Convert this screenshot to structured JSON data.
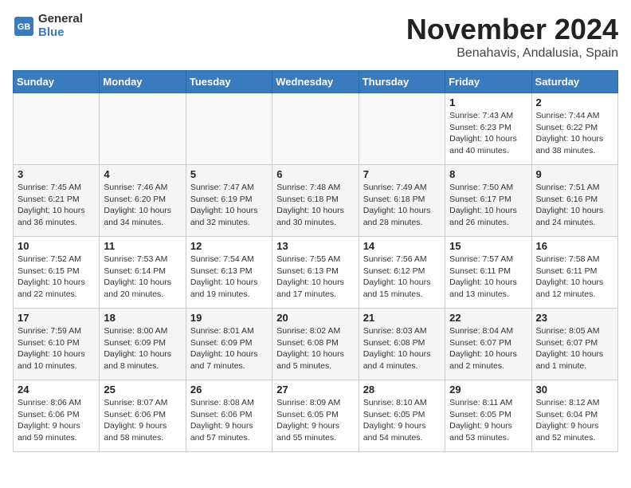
{
  "logo": {
    "line1": "General",
    "line2": "Blue"
  },
  "title": "November 2024",
  "location": "Benahavis, Andalusia, Spain",
  "days_of_week": [
    "Sunday",
    "Monday",
    "Tuesday",
    "Wednesday",
    "Thursday",
    "Friday",
    "Saturday"
  ],
  "weeks": [
    [
      {
        "day": "",
        "info": ""
      },
      {
        "day": "",
        "info": ""
      },
      {
        "day": "",
        "info": ""
      },
      {
        "day": "",
        "info": ""
      },
      {
        "day": "",
        "info": ""
      },
      {
        "day": "1",
        "info": "Sunrise: 7:43 AM\nSunset: 6:23 PM\nDaylight: 10 hours and 40 minutes."
      },
      {
        "day": "2",
        "info": "Sunrise: 7:44 AM\nSunset: 6:22 PM\nDaylight: 10 hours and 38 minutes."
      }
    ],
    [
      {
        "day": "3",
        "info": "Sunrise: 7:45 AM\nSunset: 6:21 PM\nDaylight: 10 hours and 36 minutes."
      },
      {
        "day": "4",
        "info": "Sunrise: 7:46 AM\nSunset: 6:20 PM\nDaylight: 10 hours and 34 minutes."
      },
      {
        "day": "5",
        "info": "Sunrise: 7:47 AM\nSunset: 6:19 PM\nDaylight: 10 hours and 32 minutes."
      },
      {
        "day": "6",
        "info": "Sunrise: 7:48 AM\nSunset: 6:18 PM\nDaylight: 10 hours and 30 minutes."
      },
      {
        "day": "7",
        "info": "Sunrise: 7:49 AM\nSunset: 6:18 PM\nDaylight: 10 hours and 28 minutes."
      },
      {
        "day": "8",
        "info": "Sunrise: 7:50 AM\nSunset: 6:17 PM\nDaylight: 10 hours and 26 minutes."
      },
      {
        "day": "9",
        "info": "Sunrise: 7:51 AM\nSunset: 6:16 PM\nDaylight: 10 hours and 24 minutes."
      }
    ],
    [
      {
        "day": "10",
        "info": "Sunrise: 7:52 AM\nSunset: 6:15 PM\nDaylight: 10 hours and 22 minutes."
      },
      {
        "day": "11",
        "info": "Sunrise: 7:53 AM\nSunset: 6:14 PM\nDaylight: 10 hours and 20 minutes."
      },
      {
        "day": "12",
        "info": "Sunrise: 7:54 AM\nSunset: 6:13 PM\nDaylight: 10 hours and 19 minutes."
      },
      {
        "day": "13",
        "info": "Sunrise: 7:55 AM\nSunset: 6:13 PM\nDaylight: 10 hours and 17 minutes."
      },
      {
        "day": "14",
        "info": "Sunrise: 7:56 AM\nSunset: 6:12 PM\nDaylight: 10 hours and 15 minutes."
      },
      {
        "day": "15",
        "info": "Sunrise: 7:57 AM\nSunset: 6:11 PM\nDaylight: 10 hours and 13 minutes."
      },
      {
        "day": "16",
        "info": "Sunrise: 7:58 AM\nSunset: 6:11 PM\nDaylight: 10 hours and 12 minutes."
      }
    ],
    [
      {
        "day": "17",
        "info": "Sunrise: 7:59 AM\nSunset: 6:10 PM\nDaylight: 10 hours and 10 minutes."
      },
      {
        "day": "18",
        "info": "Sunrise: 8:00 AM\nSunset: 6:09 PM\nDaylight: 10 hours and 8 minutes."
      },
      {
        "day": "19",
        "info": "Sunrise: 8:01 AM\nSunset: 6:09 PM\nDaylight: 10 hours and 7 minutes."
      },
      {
        "day": "20",
        "info": "Sunrise: 8:02 AM\nSunset: 6:08 PM\nDaylight: 10 hours and 5 minutes."
      },
      {
        "day": "21",
        "info": "Sunrise: 8:03 AM\nSunset: 6:08 PM\nDaylight: 10 hours and 4 minutes."
      },
      {
        "day": "22",
        "info": "Sunrise: 8:04 AM\nSunset: 6:07 PM\nDaylight: 10 hours and 2 minutes."
      },
      {
        "day": "23",
        "info": "Sunrise: 8:05 AM\nSunset: 6:07 PM\nDaylight: 10 hours and 1 minute."
      }
    ],
    [
      {
        "day": "24",
        "info": "Sunrise: 8:06 AM\nSunset: 6:06 PM\nDaylight: 9 hours and 59 minutes."
      },
      {
        "day": "25",
        "info": "Sunrise: 8:07 AM\nSunset: 6:06 PM\nDaylight: 9 hours and 58 minutes."
      },
      {
        "day": "26",
        "info": "Sunrise: 8:08 AM\nSunset: 6:06 PM\nDaylight: 9 hours and 57 minutes."
      },
      {
        "day": "27",
        "info": "Sunrise: 8:09 AM\nSunset: 6:05 PM\nDaylight: 9 hours and 55 minutes."
      },
      {
        "day": "28",
        "info": "Sunrise: 8:10 AM\nSunset: 6:05 PM\nDaylight: 9 hours and 54 minutes."
      },
      {
        "day": "29",
        "info": "Sunrise: 8:11 AM\nSunset: 6:05 PM\nDaylight: 9 hours and 53 minutes."
      },
      {
        "day": "30",
        "info": "Sunrise: 8:12 AM\nSunset: 6:04 PM\nDaylight: 9 hours and 52 minutes."
      }
    ]
  ]
}
